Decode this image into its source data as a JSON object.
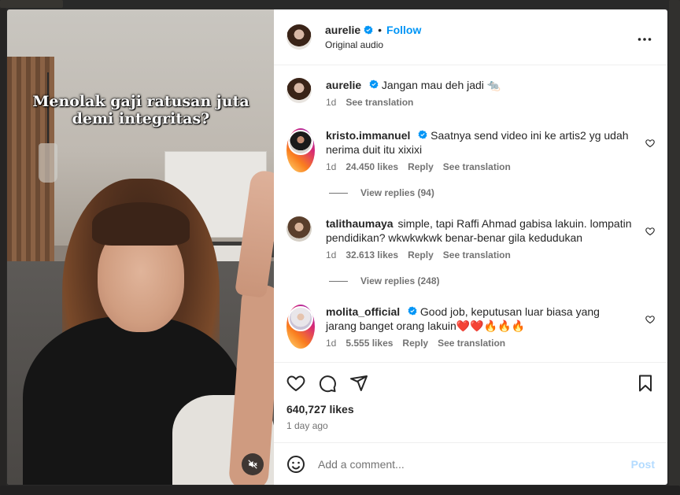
{
  "post": {
    "username": "aurelie",
    "dot": "•",
    "follow_label": "Follow",
    "audio": "Original audio",
    "more_label": "•••"
  },
  "video": {
    "caption_line1": "Menolak gaji ratusan juta",
    "caption_line2": "demi integritas?"
  },
  "comments": [
    {
      "username": "aurelie",
      "text": "Jangan mau deh jadi 🐀",
      "time": "1d",
      "likes": "",
      "reply": "",
      "see_translation": "See translation"
    },
    {
      "username": "kristo.immanuel",
      "text": "Saatnya send video ini ke artis2 yg udah nerima duit itu xixixi",
      "time": "1d",
      "likes": "24.450 likes",
      "reply": "Reply",
      "see_translation": "See translation",
      "view_replies": "View replies (94)"
    },
    {
      "username": "talithaumaya",
      "text": "simple, tapi Raffi Ahmad gabisa lakuin. lompatin pendidikan? wkwkwkwk benar-benar gila kedudukan",
      "time": "1d",
      "likes": "32.613 likes",
      "reply": "Reply",
      "see_translation": "See translation",
      "view_replies": "View replies (248)"
    },
    {
      "username": "molita_official",
      "text": "Good job, keputusan luar biasa yang jarang banget orang lakuin❤️❤️🔥🔥🔥",
      "time": "1d",
      "likes": "5.555 likes",
      "reply": "Reply",
      "see_translation": "See translation"
    }
  ],
  "likes_count": "640,727 likes",
  "posted": "1 day ago",
  "add_comment": {
    "placeholder": "Add a comment...",
    "post_label": "Post"
  },
  "colors": {
    "accent": "#0095f6",
    "muted": "#737373",
    "post_disabled": "#b3dbff"
  }
}
